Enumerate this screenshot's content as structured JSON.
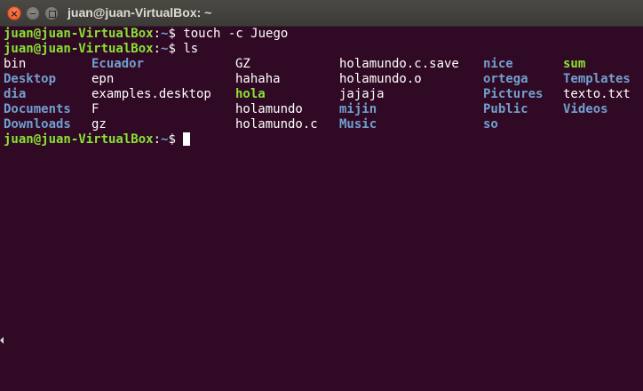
{
  "window": {
    "title": "juan@juan-VirtualBox: ~",
    "close_glyph": "×",
    "colors": {
      "background": "#300a24",
      "titlebar": "#3c3b37",
      "title_text": "#dfdbd2",
      "close_button": "#e2501f",
      "prompt_user": "#8ae234",
      "prompt_path": "#729fcf",
      "directory": "#729fcf",
      "executable": "#8ae234",
      "file": "#ffffff"
    }
  },
  "terminal": {
    "prompt": {
      "user_host": "juan@juan-VirtualBox",
      "colon": ":",
      "path": "~",
      "symbol": "$ "
    },
    "commands": [
      {
        "text": "touch -c Juego"
      },
      {
        "text": "ls"
      }
    ],
    "ls_output": [
      [
        {
          "name": "bin",
          "type": "file"
        },
        {
          "name": "Ecuador",
          "type": "directory"
        },
        {
          "name": "GZ",
          "type": "file"
        },
        {
          "name": "holamundo.c.save",
          "type": "file"
        },
        {
          "name": "nice",
          "type": "directory"
        },
        {
          "name": "sum",
          "type": "executable"
        }
      ],
      [
        {
          "name": "Desktop",
          "type": "directory"
        },
        {
          "name": "epn",
          "type": "file"
        },
        {
          "name": "hahaha",
          "type": "file"
        },
        {
          "name": "holamundo.o",
          "type": "file"
        },
        {
          "name": "ortega",
          "type": "directory"
        },
        {
          "name": "Templates",
          "type": "directory"
        }
      ],
      [
        {
          "name": "dia",
          "type": "directory"
        },
        {
          "name": "examples.desktop",
          "type": "file"
        },
        {
          "name": "hola",
          "type": "executable"
        },
        {
          "name": "jajaja",
          "type": "file"
        },
        {
          "name": "Pictures",
          "type": "directory"
        },
        {
          "name": "texto.txt",
          "type": "file"
        }
      ],
      [
        {
          "name": "Documents",
          "type": "directory"
        },
        {
          "name": "F",
          "type": "file"
        },
        {
          "name": "holamundo",
          "type": "file"
        },
        {
          "name": "mijin",
          "type": "directory"
        },
        {
          "name": "Public",
          "type": "directory"
        },
        {
          "name": "Videos",
          "type": "directory"
        }
      ],
      [
        {
          "name": "Downloads",
          "type": "directory"
        },
        {
          "name": "gz",
          "type": "file"
        },
        {
          "name": "holamundo.c",
          "type": "file"
        },
        {
          "name": "Music",
          "type": "directory"
        },
        {
          "name": "so",
          "type": "directory"
        }
      ]
    ]
  }
}
